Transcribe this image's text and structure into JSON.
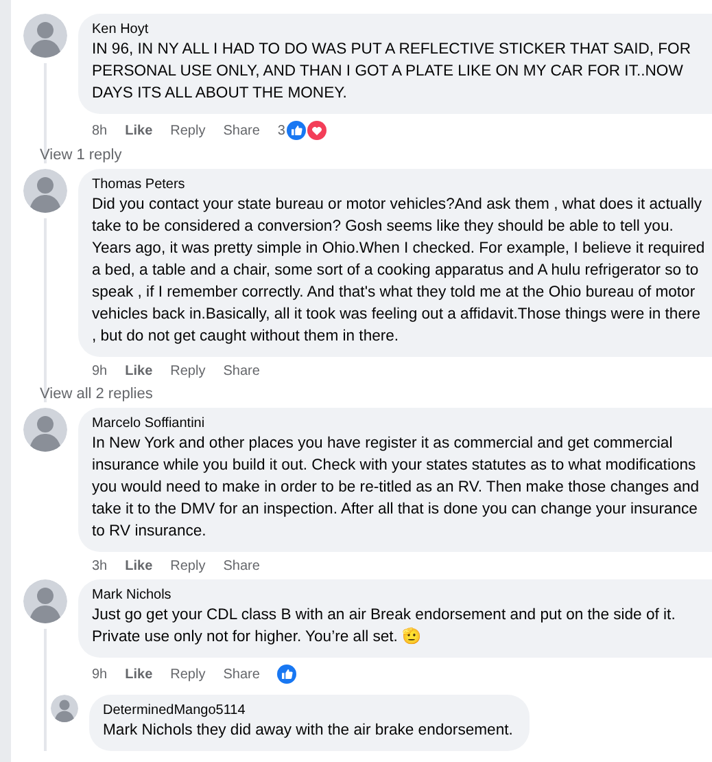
{
  "comments": [
    {
      "author": "Ken Hoyt",
      "text": "IN 96, IN NY ALL I HAD TO DO WAS PUT A REFLECTIVE STICKER THAT SAID, FOR PERSONAL USE ONLY, AND THAN I GOT A PLATE LIKE ON MY CAR FOR IT..NOW DAYS ITS ALL ABOUT THE MONEY.",
      "time": "8h",
      "actions": [
        "Like",
        "Reply",
        "Share"
      ],
      "reaction_count": "3",
      "reactions": [
        {
          "kind": "like"
        },
        {
          "kind": "love"
        }
      ],
      "view_replies": "View 1 reply"
    },
    {
      "author": "Thomas Peters",
      "text": "Did you contact your state bureau or motor vehicles?And ask them , what does it actually take to be considered a conversion? Gosh seems like they should be able to tell you. Years ago, it was pretty simple in Ohio.When I checked. For example, I believe it required a bed, a table and a chair, some sort of a cooking apparatus and A hulu refrigerator so to speak , if I remember correctly. And that's what they told me at the Ohio bureau of motor vehicles back in.Basically, all it took was feeling out a affidavit.Those things were in there , but do not get caught without them in there.",
      "time": "9h",
      "actions": [
        "Like",
        "Reply",
        "Share"
      ],
      "view_replies": "View all 2 replies"
    },
    {
      "author": "Marcelo Soffiantini",
      "text": "In New York and other places you have register it as commercial and get commercial insurance while you build it out. Check with your states statutes as to what modifications you would need to make in order to be re-titled as an RV. Then make those changes and take it to the DMV for an inspection. After all that is done you can change your insurance to RV insurance.",
      "time": "3h",
      "actions": [
        "Like",
        "Reply",
        "Share"
      ]
    },
    {
      "author": "Mark Nichols",
      "text": "Just go get your CDL class B with an air Break endorsement and put on the side of it. Private use only not for higher. You’re all set. 🫡",
      "time": "9h",
      "actions": [
        "Like",
        "Reply",
        "Share"
      ],
      "reactions": [
        {
          "kind": "like"
        }
      ],
      "replies": [
        {
          "author": "DeterminedMango5114",
          "text": "Mark Nichols they did away with the air brake endorsement."
        }
      ]
    }
  ]
}
